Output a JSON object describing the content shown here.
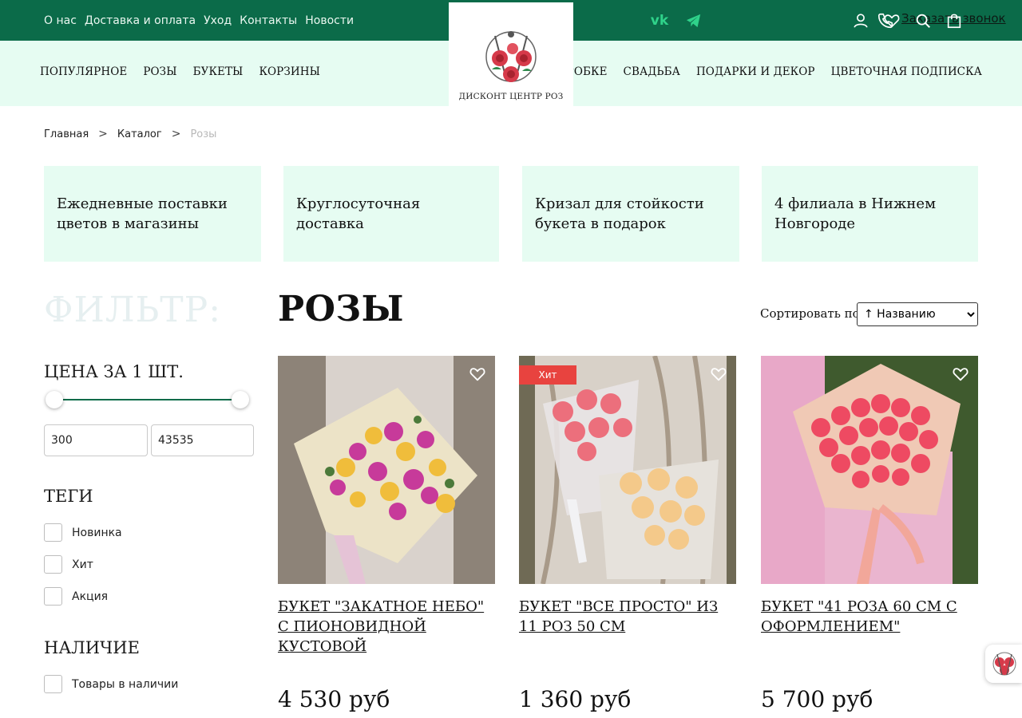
{
  "header": {
    "top_links": [
      "О нас",
      "Доставка и оплата",
      "Уход",
      "Контакты",
      "Новости"
    ],
    "call_label": "Заказать звонок",
    "colors": {
      "top_bar": "#0b6b49",
      "cat_bar": "#e6fcf2",
      "accent": "#2fd28a"
    }
  },
  "nav": {
    "left": [
      "ПОПУЛЯРНОЕ",
      "РОЗЫ",
      "БУКЕТЫ",
      "КОРЗИНЫ"
    ],
    "right": [
      "В КОРОБКЕ",
      "СВАДЬБА",
      "ПОДАРКИ И ДЕКОР",
      "ЦВЕТОЧНАЯ ПОДПИСКА"
    ]
  },
  "logo": {
    "text": "ДИСКОНТ ЦЕНТР РОЗ"
  },
  "breadcrumb": {
    "items": [
      "Главная",
      "Каталог",
      "Розы"
    ],
    "separator": ">"
  },
  "features": [
    "Ежедневные поставки цветов в магазины",
    "Круглосуточная доставка",
    "Кризал для стойкости букета в подарок",
    "4 филиала в Нижнем Новгороде"
  ],
  "filter": {
    "title": "ФИЛЬТР:",
    "price_heading": "ЦЕНА ЗА 1 ШТ.",
    "price_min": "300",
    "price_max": "43535",
    "tags_heading": "ТЕГИ",
    "tags": [
      "Новинка",
      "Хит",
      "Акция"
    ],
    "availability_heading": "НАЛИЧИЕ",
    "availability": [
      "Товары в наличии"
    ]
  },
  "main": {
    "title": "РОЗЫ",
    "sort_label": "Сортировать по:",
    "sort_value": "↑ Названию"
  },
  "products": [
    {
      "name": "Букет \"Закатное небо\" с пионовидной кустовой",
      "price": "4 530 руб",
      "badge": ""
    },
    {
      "name": "Букет \"Все просто\" из 11 роз 50 см",
      "price": "1 360 руб",
      "badge": "Хит"
    },
    {
      "name": "Букет \"41 роза 60 см с оформлением\"",
      "price": "5 700 руб",
      "badge": ""
    }
  ]
}
